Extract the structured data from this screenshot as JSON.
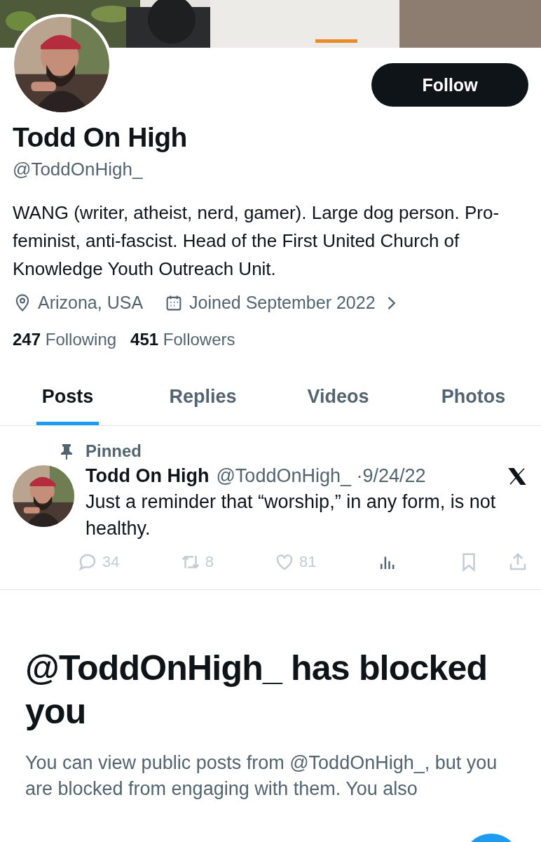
{
  "follow_button": "Follow",
  "profile": {
    "name": "Todd On High",
    "handle": "@ToddOnHigh_",
    "bio": "WANG (writer, atheist, nerd, gamer). Large dog person. Pro-feminist, anti-fascist. Head of the First United Church of Knowledge Youth Outreach Unit.",
    "location": "Arizona, USA",
    "joined": "Joined September 2022"
  },
  "stats": [
    {
      "count": "247",
      "label": "Following"
    },
    {
      "count": "451",
      "label": "Followers"
    }
  ],
  "tabs": [
    {
      "label": "Posts",
      "selected": true
    },
    {
      "label": "Replies",
      "selected": false
    },
    {
      "label": "Videos",
      "selected": false
    },
    {
      "label": "Photos",
      "selected": false
    }
  ],
  "pinned_post": {
    "pin_label": "Pinned",
    "name": "Todd On High",
    "handle": "@ToddOnHigh_",
    "date": "·9/24/22",
    "text": "Just a reminder that “worship,” in any form, is not healthy.",
    "actions": [
      {
        "kind": "reply",
        "count": "34"
      },
      {
        "kind": "repost",
        "count": "8"
      },
      {
        "kind": "like",
        "count": "81"
      },
      {
        "kind": "views"
      },
      {
        "kind": "bookmark"
      },
      {
        "kind": "share"
      }
    ]
  },
  "blocked_notice": {
    "title": "@ToddOnHigh_ has blocked you",
    "text": "You can view public posts from @ToddOnHigh_, but you are blocked from engaging with them. You also"
  }
}
